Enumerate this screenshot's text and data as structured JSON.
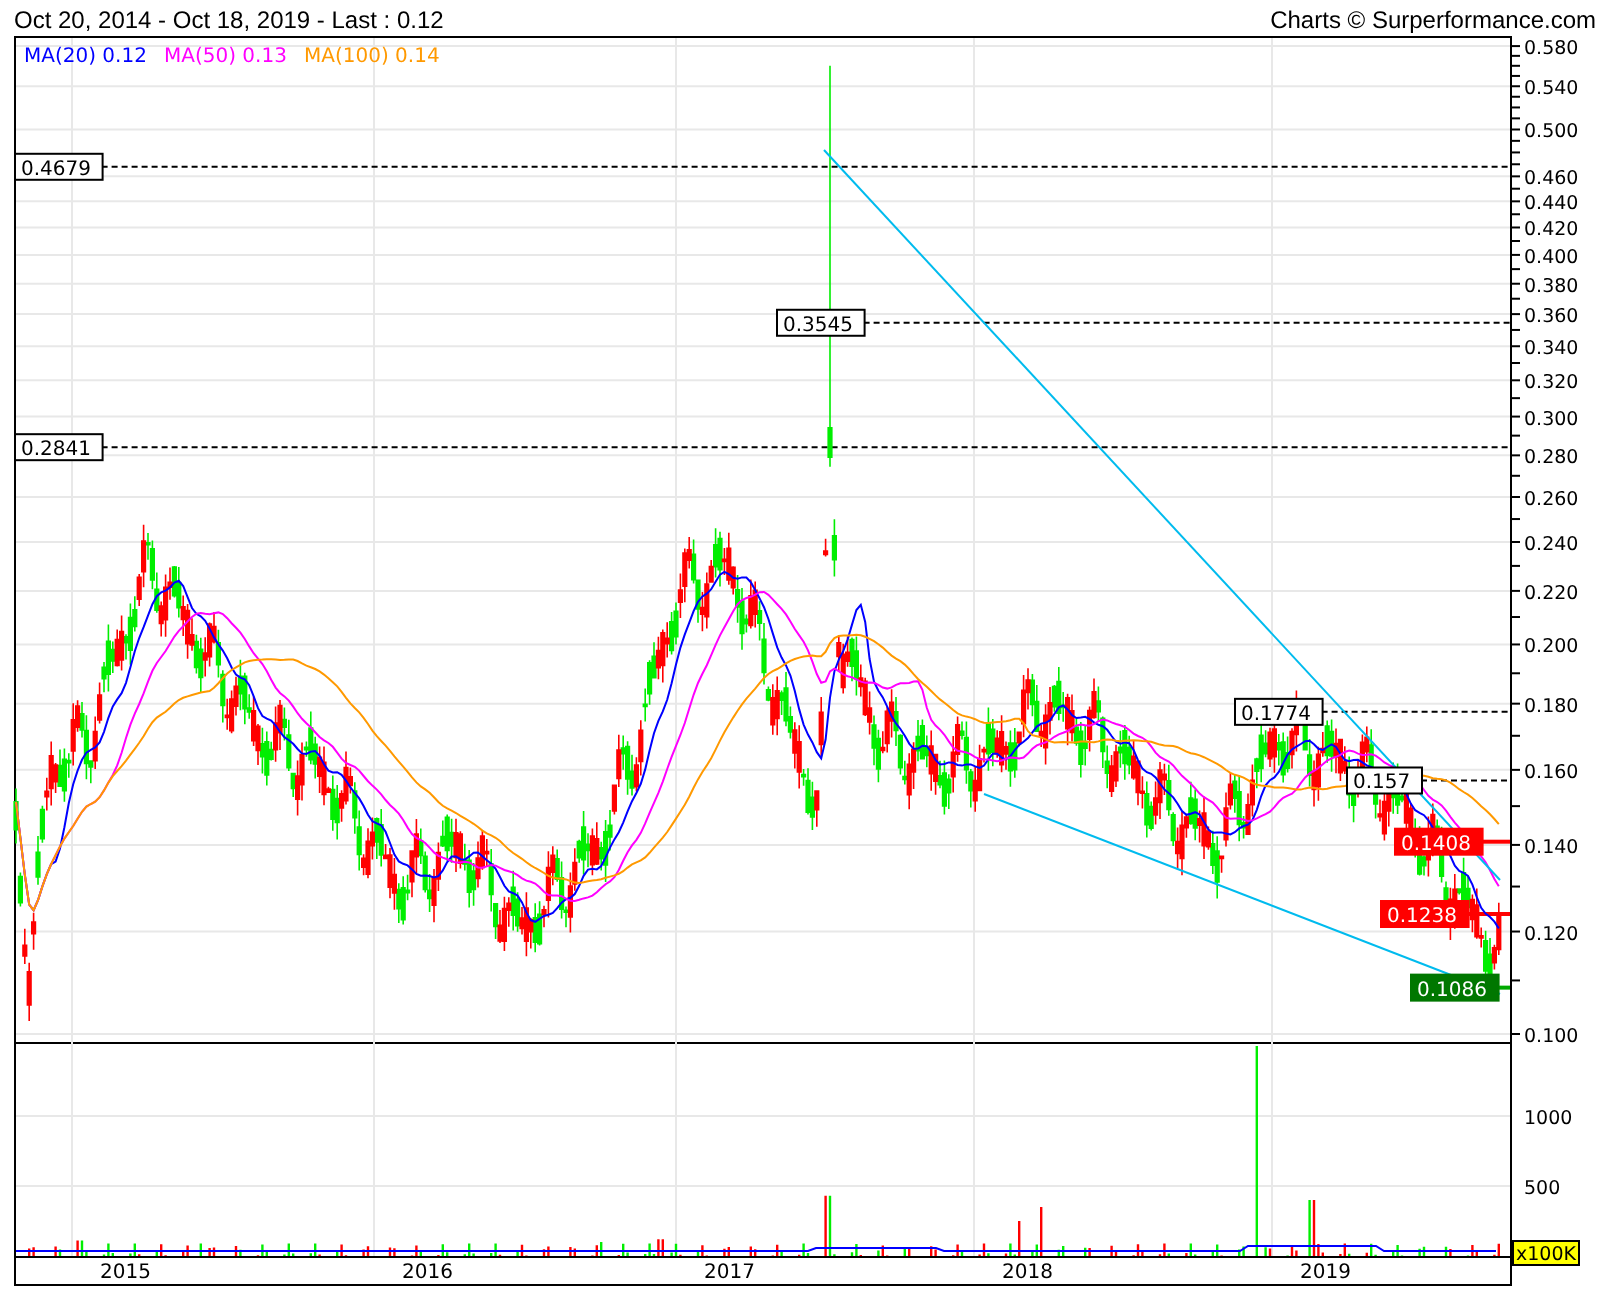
{
  "header": {
    "range": "Oct 20, 2014 - Oct 18, 2019 - Last : 0.12",
    "credit": "Charts © Surperformance.com"
  },
  "legend": [
    {
      "label": "MA(20)",
      "value": "0.12",
      "color": "#0000ff"
    },
    {
      "label": "MA(50)",
      "value": "0.13",
      "color": "#ff00ff"
    },
    {
      "label": "MA(100)",
      "value": "0.14",
      "color": "#ff9900"
    }
  ],
  "price_axis": [
    "0.580",
    "0.540",
    "0.500",
    "0.460",
    "0.440",
    "0.420",
    "0.400",
    "0.380",
    "0.360",
    "0.340",
    "0.320",
    "0.300",
    "0.280",
    "0.260",
    "0.240",
    "0.220",
    "0.200",
    "0.180",
    "0.160",
    "0.140",
    "0.120",
    "0.100"
  ],
  "levels": [
    {
      "label": "0.4679",
      "kind": "marker"
    },
    {
      "label": "0.3545",
      "kind": "marker"
    },
    {
      "label": "0.2841",
      "kind": "marker"
    },
    {
      "label": "0.1774",
      "kind": "marker"
    },
    {
      "label": "0.157",
      "kind": "marker"
    },
    {
      "label": "0.1408",
      "kind": "sell"
    },
    {
      "label": "0.1238",
      "kind": "sell"
    },
    {
      "label": "0.1086",
      "kind": "buy"
    }
  ],
  "volume_axis": {
    "ticks": [
      "1000",
      "500"
    ],
    "unit": "x100K"
  },
  "years": [
    "2015",
    "2016",
    "2017",
    "2018",
    "2019"
  ]
}
